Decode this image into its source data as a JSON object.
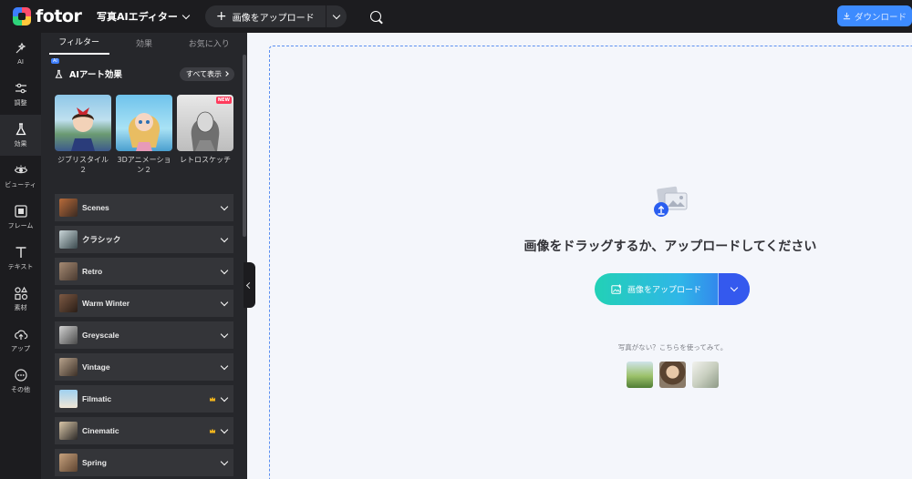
{
  "topbar": {
    "logo_text": "fotor",
    "editor_menu": "写真AIエディター",
    "upload_label": "画像をアップロード",
    "download_label": "ダウンロード"
  },
  "rail": {
    "items": [
      {
        "label": "AI",
        "icon": "ai-sparkle-icon"
      },
      {
        "label": "調整",
        "icon": "sliders-icon"
      },
      {
        "label": "効果",
        "icon": "flask-icon"
      },
      {
        "label": "ビューティ",
        "icon": "eye-icon"
      },
      {
        "label": "フレーム",
        "icon": "frame-icon"
      },
      {
        "label": "テキスト",
        "icon": "text-icon"
      },
      {
        "label": "素材",
        "icon": "elements-icon"
      },
      {
        "label": "アップ",
        "icon": "cloud-upload-icon"
      },
      {
        "label": "その他",
        "icon": "more-icon"
      }
    ],
    "active_index": 2
  },
  "panel": {
    "tabs": [
      "フィルター",
      "効果",
      "お気に入り"
    ],
    "active_tab": 0,
    "ai_section": {
      "badge": "AI",
      "title": "AIアート効果",
      "show_all": "すべて表示"
    },
    "cards": [
      {
        "label": "ジブリスタイル２",
        "badge": ""
      },
      {
        "label": "3Dアニメーション２",
        "badge": ""
      },
      {
        "label": "レトロスケッチ",
        "badge": "NEW"
      }
    ],
    "filters": [
      {
        "name": "Scenes",
        "premium": false
      },
      {
        "name": "クラシック",
        "premium": false
      },
      {
        "name": "Retro",
        "premium": false
      },
      {
        "name": "Warm Winter",
        "premium": false
      },
      {
        "name": "Greyscale",
        "premium": false
      },
      {
        "name": "Vintage",
        "premium": false
      },
      {
        "name": "Filmatic",
        "premium": true
      },
      {
        "name": "Cinematic",
        "premium": true
      },
      {
        "name": "Spring",
        "premium": false
      }
    ]
  },
  "canvas": {
    "drop_title": "画像をドラッグするか、アップロードしてください",
    "upload_button": "画像をアップロード",
    "sample_hint": "写真がない？こちらを使ってみて。"
  },
  "colors": {
    "accent": "#3d7eff",
    "dark_bg": "#1c1c1f",
    "panel_bg": "#26272b",
    "canvas_bg": "#f4f6fb",
    "premium": "#f2b51d"
  }
}
